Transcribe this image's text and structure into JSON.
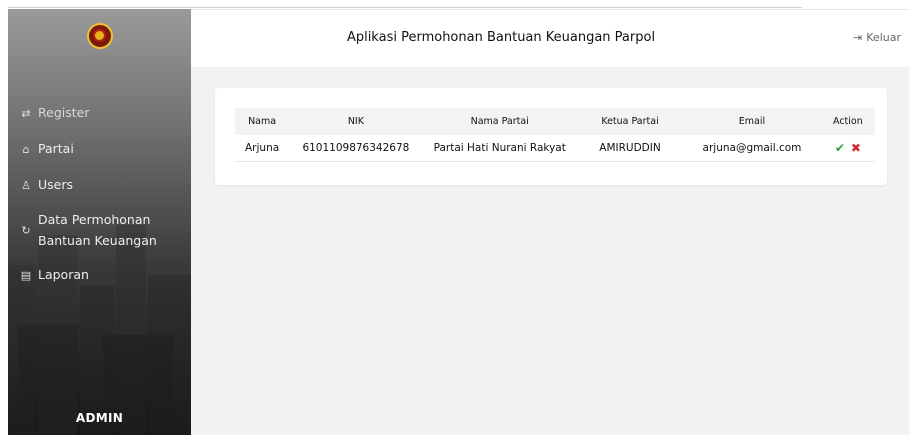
{
  "header": {
    "title": "Aplikasi Permohonan Bantuan Keuangan Parpol",
    "logout_label": "Keluar",
    "logout_icon": "logout-arrow-icon"
  },
  "sidebar": {
    "logo_icon": "emblem-logo",
    "items": [
      {
        "label": "Register",
        "icon": "arrows-exchange-icon"
      },
      {
        "label": "Partai",
        "icon": "building-icon"
      },
      {
        "label": "Users",
        "icon": "user-icon"
      },
      {
        "label": "Data Permohonan Bantuan Keuangan",
        "icon": "refresh-icon"
      },
      {
        "label": "Laporan",
        "icon": "document-icon"
      }
    ],
    "role_label": "ADMIN"
  },
  "table": {
    "columns": [
      "Nama",
      "NIK",
      "Nama Partai",
      "Ketua Partai",
      "Email",
      "Action"
    ],
    "rows": [
      {
        "nama": "Arjuna",
        "nik": "6101109876342678",
        "nama_partai": "Partai Hati Nurani Rakyat",
        "ketua_partai": "AMIRUDDIN",
        "email": "arjuna@gmail.com",
        "actions": [
          "approve-check-icon",
          "reject-cross-icon"
        ]
      }
    ]
  },
  "colors": {
    "approve": "#2e9e3a",
    "reject": "#d12b2b",
    "main_bg": "#f2f2f2"
  }
}
